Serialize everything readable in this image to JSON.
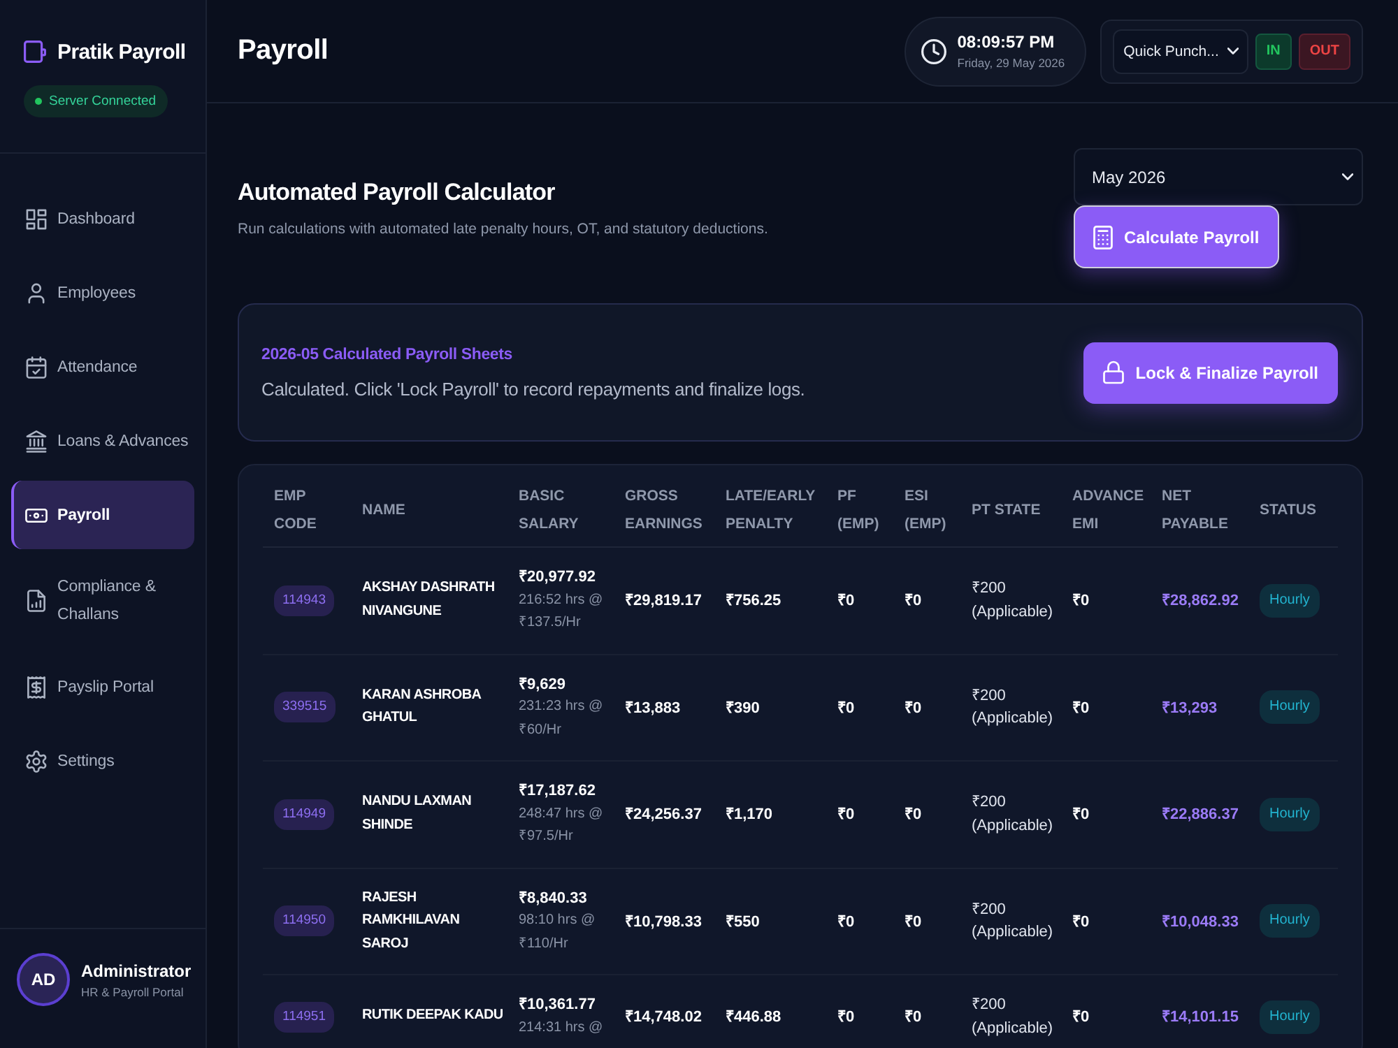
{
  "sidebar": {
    "brand": "Pratik Payroll",
    "server_status": {
      "label": "Server Connected",
      "connected": true
    },
    "items": [
      {
        "label": "Dashboard",
        "selected": false
      },
      {
        "label": "Employees",
        "selected": false
      },
      {
        "label": "Attendance",
        "selected": false
      },
      {
        "label": "Loans & Advances",
        "selected": false
      },
      {
        "label": "Payroll",
        "selected": true
      },
      {
        "label": "Compliance & Challans",
        "selected": false
      },
      {
        "label": "Payslip Portal",
        "selected": false
      },
      {
        "label": "Settings",
        "selected": false
      }
    ],
    "user": {
      "initials": "AD",
      "name": "Administrator",
      "role": "HR & Payroll Portal"
    }
  },
  "header": {
    "title": "Payroll",
    "clock": {
      "time": "08:09:57 PM",
      "date": "Friday, 29 May 2026"
    },
    "quick_punch": {
      "value": "Quick Punch...",
      "buttons": [
        {
          "label": "IN",
          "kind": "in"
        },
        {
          "label": "OUT",
          "kind": "out"
        }
      ]
    }
  },
  "calculator": {
    "title": "Automated Payroll Calculator",
    "subtitle": "Run calculations with automated late penalty hours, OT, and statutory deductions.",
    "month": "May 2026",
    "calculate_button": "Calculate Payroll"
  },
  "status_card": {
    "heading": "2026-05 Calculated Payroll Sheets",
    "message": "Calculated. Click 'Lock Payroll' to record repayments and finalize logs.",
    "lock_button": "Lock & Finalize Payroll"
  },
  "table": {
    "columns": [
      "EMP CODE",
      "NAME",
      "BASIC SALARY",
      "GROSS EARNINGS",
      "LATE/EARLY PENALTY",
      "PF (EMP)",
      "ESI (EMP)",
      "PT STATE",
      "ADVANCE EMI",
      "NET PAYABLE",
      "STATUS"
    ],
    "rows": [
      {
        "emp_code": "114943",
        "name": "AKSHAY DASHRATH NIVANGUNE",
        "basic_salary": "₹20,977.92",
        "hours_rate": "216:52 hrs @ ₹137.5/Hr",
        "gross_earnings": "₹29,819.17",
        "late_early_penalty": "₹756.25",
        "pf_emp": "₹0",
        "esi_emp": "₹0",
        "pt_amount": "₹200",
        "pt_note": "(Applicable)",
        "advance_emi": "₹0",
        "net_payable": "₹28,862.92",
        "status": "Hourly"
      },
      {
        "emp_code": "339515",
        "name": "KARAN ASHROBA GHATUL",
        "basic_salary": "₹9,629",
        "hours_rate": "231:23 hrs @ ₹60/Hr",
        "gross_earnings": "₹13,883",
        "late_early_penalty": "₹390",
        "pf_emp": "₹0",
        "esi_emp": "₹0",
        "pt_amount": "₹200",
        "pt_note": "(Applicable)",
        "advance_emi": "₹0",
        "net_payable": "₹13,293",
        "status": "Hourly"
      },
      {
        "emp_code": "114949",
        "name": "NANDU LAXMAN SHINDE",
        "basic_salary": "₹17,187.62",
        "hours_rate": "248:47 hrs @ ₹97.5/Hr",
        "gross_earnings": "₹24,256.37",
        "late_early_penalty": "₹1,170",
        "pf_emp": "₹0",
        "esi_emp": "₹0",
        "pt_amount": "₹200",
        "pt_note": "(Applicable)",
        "advance_emi": "₹0",
        "net_payable": "₹22,886.37",
        "status": "Hourly"
      },
      {
        "emp_code": "114950",
        "name": "RAJESH RAMKHILAVAN SAROJ",
        "basic_salary": "₹8,840.33",
        "hours_rate": "98:10 hrs @ ₹110/Hr",
        "gross_earnings": "₹10,798.33",
        "late_early_penalty": "₹550",
        "pf_emp": "₹0",
        "esi_emp": "₹0",
        "pt_amount": "₹200",
        "pt_note": "(Applicable)",
        "advance_emi": "₹0",
        "net_payable": "₹10,048.33",
        "status": "Hourly"
      },
      {
        "emp_code": "114951",
        "name": "RUTIK DEEPAK KADU",
        "basic_salary": "₹10,361.77",
        "hours_rate": "214:31 hrs @",
        "gross_earnings": "₹14,748.02",
        "late_early_penalty": "₹446.88",
        "pf_emp": "₹0",
        "esi_emp": "₹0",
        "pt_amount": "₹200",
        "pt_note": "(Applicable)",
        "advance_emi": "₹0",
        "net_payable": "₹14,101.15",
        "status": "Hourly"
      }
    ]
  }
}
